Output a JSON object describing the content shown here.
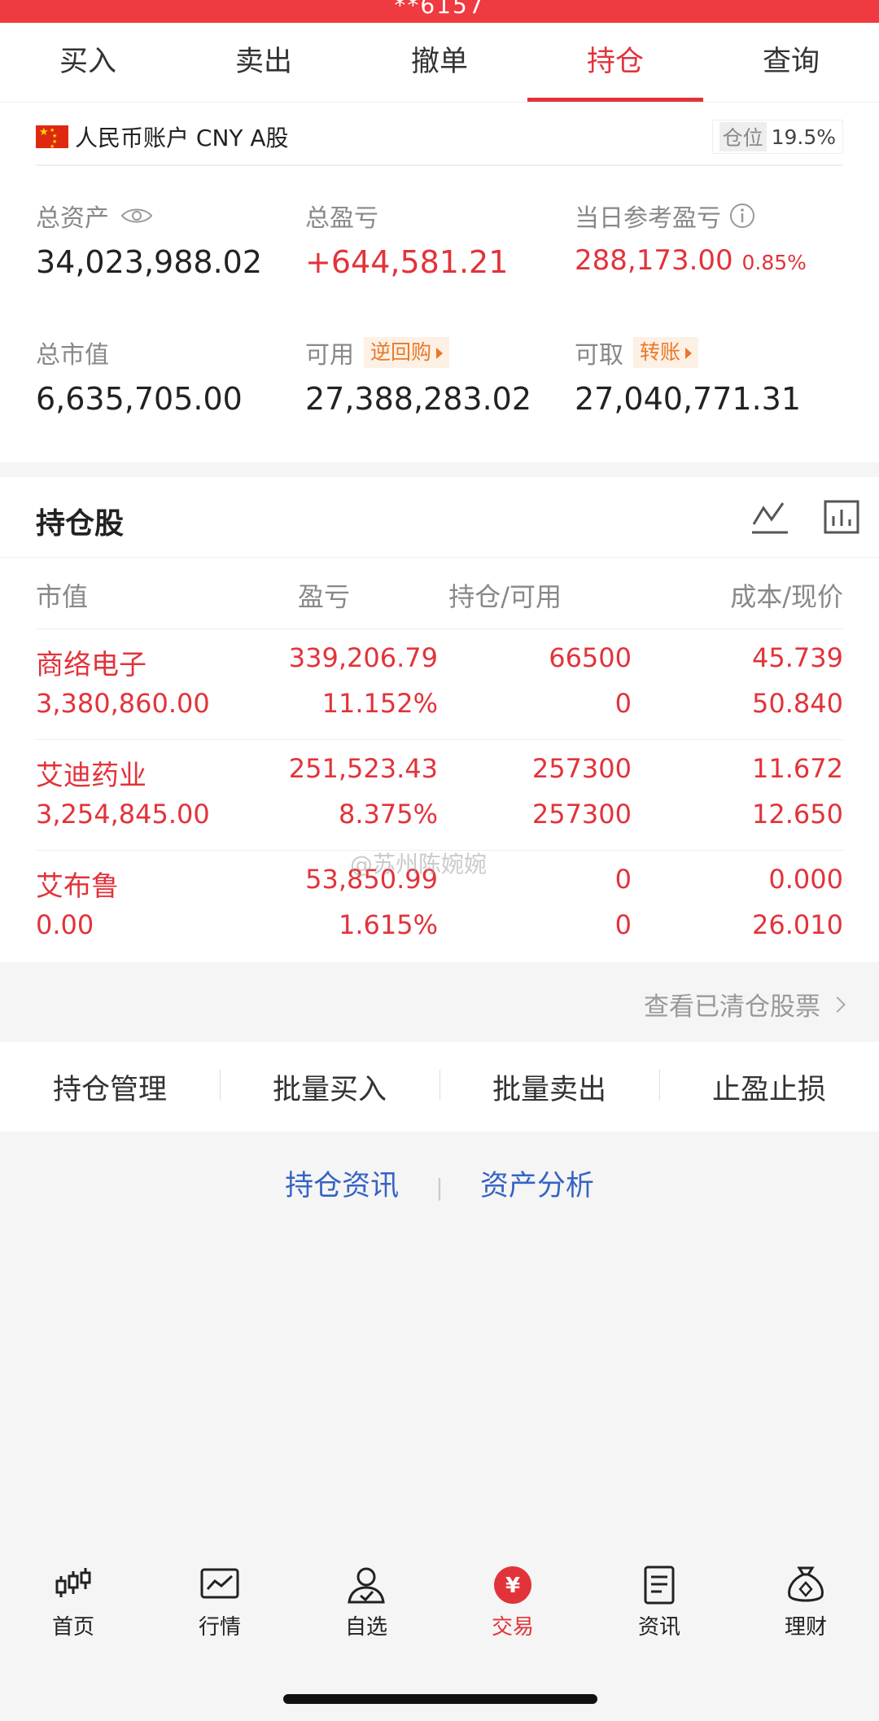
{
  "status_strip": "**6157",
  "tabs": [
    {
      "label": "买入"
    },
    {
      "label": "卖出"
    },
    {
      "label": "撤单"
    },
    {
      "label": "持仓"
    },
    {
      "label": "查询"
    }
  ],
  "account": {
    "name": "人民币账户 CNY A股",
    "position_label": "仓位",
    "position_value": "19.5%",
    "total_assets_label": "总资产",
    "total_assets": "34,023,988.02",
    "total_pl_label": "总盈亏",
    "total_pl": "+644,581.21",
    "daily_pl_label": "当日参考盈亏",
    "daily_pl": "288,173.00",
    "daily_pl_pct": "0.85%",
    "market_value_label": "总市值",
    "market_value": "6,635,705.00",
    "available_label": "可用",
    "available_tag": "逆回购",
    "available": "27,388,283.02",
    "withdrawable_label": "可取",
    "withdrawable_tag": "转账",
    "withdrawable": "27,040,771.31"
  },
  "holdings": {
    "title": "持仓股",
    "headers": {
      "market_value": "市值",
      "pl": "盈亏",
      "position": "持仓/可用",
      "cost": "成本/现价"
    },
    "rows": [
      {
        "name": "商络电子",
        "market_value": "3,380,860.00",
        "pl": "339,206.79",
        "pl_pct": "11.152%",
        "position": "66500",
        "available": "0",
        "cost": "45.739",
        "price": "50.840"
      },
      {
        "name": "艾迪药业",
        "market_value": "3,254,845.00",
        "pl": "251,523.43",
        "pl_pct": "8.375%",
        "position": "257300",
        "available": "257300",
        "cost": "11.672",
        "price": "12.650"
      },
      {
        "name": "艾布鲁",
        "market_value": "0.00",
        "pl": "53,850.99",
        "pl_pct": "1.615%",
        "position": "0",
        "available": "0",
        "cost": "0.000",
        "price": "26.010"
      }
    ],
    "cleared_link": "查看已清仓股票"
  },
  "watermark": "@苏州陈婉婉",
  "actions": [
    {
      "label": "持仓管理"
    },
    {
      "label": "批量买入"
    },
    {
      "label": "批量卖出"
    },
    {
      "label": "止盈止损"
    }
  ],
  "links": {
    "news": "持仓资讯",
    "analysis": "资产分析"
  },
  "bottom_nav": [
    {
      "label": "首页",
      "icon": "candlestick-icon"
    },
    {
      "label": "行情",
      "icon": "chart-icon"
    },
    {
      "label": "自选",
      "icon": "person-check-icon"
    },
    {
      "label": "交易",
      "icon": "yen-icon",
      "symbol": "¥"
    },
    {
      "label": "资讯",
      "icon": "document-icon"
    },
    {
      "label": "理财",
      "icon": "money-bag-icon"
    }
  ],
  "colors": {
    "accent": "#e2333a",
    "tag": "#e8792a",
    "link": "#3763c4"
  }
}
